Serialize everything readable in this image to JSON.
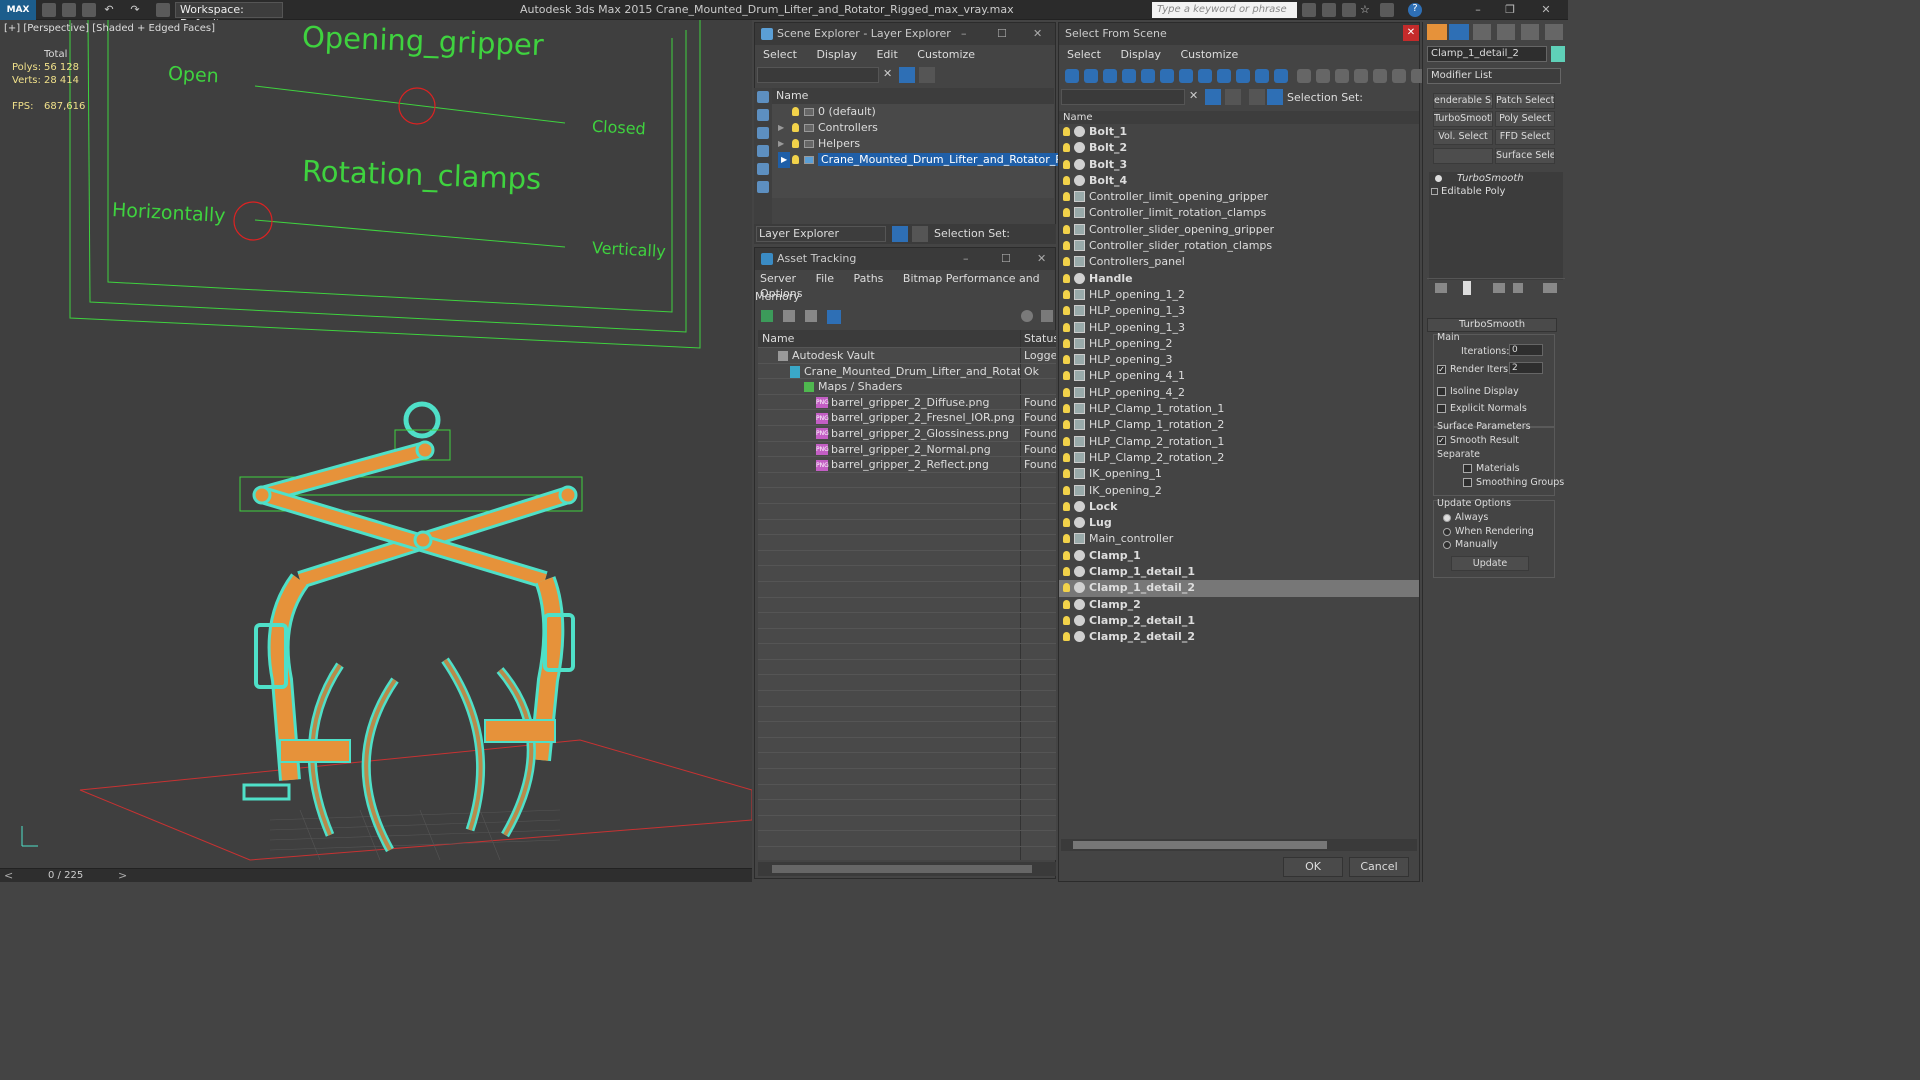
{
  "titlebar": {
    "logo": "MAX",
    "workspace": "Workspace: Default",
    "title": "Autodesk 3ds Max  2015    Crane_Mounted_Drum_Lifter_and_Rotator_Rigged_max_vray.max",
    "search_placeholder": "Type a keyword or phrase"
  },
  "viewport": {
    "label": "[+] [Perspective] [Shaded + Edged Faces]",
    "stats": {
      "header": "Total",
      "polys_label": "Polys:",
      "polys": "56 128",
      "verts_label": "Verts:",
      "verts": "28 414",
      "fps_label": "FPS:",
      "fps": "687,616"
    },
    "panel_text": {
      "opening_title": "Opening_gripper",
      "open": "Open",
      "closed": "Closed",
      "rotation_title": "Rotation_clamps",
      "horizontally": "Horizontally",
      "vertically": "Vertically"
    },
    "colors": {
      "wire": "#4fe0c8",
      "mesh": "#e6923a",
      "panel": "#3fd23f",
      "grid": "#c83232"
    }
  },
  "timeline": {
    "frame": "0 / 225"
  },
  "scene_explorer": {
    "title": "Scene Explorer - Layer Explorer",
    "menu": [
      "Select",
      "Display",
      "Edit",
      "Customize"
    ],
    "column": "Name",
    "layers": [
      "0 (default)",
      "Controllers",
      "Helpers",
      "Crane_Mounted_Drum_Lifter_and_Rotator_Rigged"
    ],
    "footer_dropdown": "Layer Explorer",
    "selection_set": "Selection Set:"
  },
  "asset_tracking": {
    "title": "Asset Tracking",
    "menu": [
      "Server",
      "File",
      "Paths",
      "Bitmap Performance and Memory",
      "Options"
    ],
    "columns": [
      "Name",
      "Status"
    ],
    "rows": [
      {
        "name": "Autodesk Vault",
        "status": "Logged"
      },
      {
        "name": "Crane_Mounted_Drum_Lifter_and_Rotator_Rigg...",
        "status": "Ok"
      },
      {
        "name": "Maps / Shaders",
        "status": ""
      },
      {
        "name": "barrel_gripper_2_Diffuse.png",
        "status": "Found"
      },
      {
        "name": "barrel_gripper_2_Fresnel_IOR.png",
        "status": "Found"
      },
      {
        "name": "barrel_gripper_2_Glossiness.png",
        "status": "Found"
      },
      {
        "name": "barrel_gripper_2_Normal.png",
        "status": "Found"
      },
      {
        "name": "barrel_gripper_2_Reflect.png",
        "status": "Found"
      }
    ],
    "png_label": "PNG"
  },
  "select_from_scene": {
    "title": "Select From Scene",
    "menu": [
      "Select",
      "Display",
      "Customize"
    ],
    "selection_set": "Selection Set:",
    "column": "Name",
    "objects": [
      "Bolt_1",
      "Bolt_2",
      "Bolt_3",
      "Bolt_4",
      "Controller_limit_opening_gripper",
      "Controller_limit_rotation_clamps",
      "Controller_slider_opening_gripper",
      "Controller_slider_rotation_clamps",
      "Controllers_panel",
      "Handle",
      "HLP_opening_1_2",
      "HLP_opening_1_3",
      "HLP_opening_1_3",
      "HLP_opening_2",
      "HLP_opening_3",
      "HLP_opening_4_1",
      "HLP_opening_4_2",
      "HLP_Clamp_1_rotation_1",
      "HLP_Clamp_1_rotation_2",
      "HLP_Clamp_2_rotation_1",
      "HLP_Clamp_2_rotation_2",
      "IK_opening_1",
      "IK_opening_2",
      "Lock",
      "Lug",
      "Main_controller",
      "Clamp_1",
      "Clamp_1_detail_1",
      "Clamp_1_detail_2",
      "Clamp_2",
      "Clamp_2_detail_1",
      "Clamp_2_detail_2"
    ],
    "ok": "OK",
    "cancel": "Cancel"
  },
  "command_panel": {
    "object_name": "Clamp_1_detail_2",
    "modifier_list": "Modifier List",
    "buttons": [
      "enderable Spli",
      "Patch Select",
      "TurboSmooth",
      "Poly Select",
      "Vol. Select",
      "FFD Select",
      "",
      "Surface Select"
    ],
    "stack": [
      "TurboSmooth",
      "Editable Poly"
    ],
    "rollout_title": "TurboSmooth",
    "main": "Main",
    "iterations_label": "Iterations:",
    "iterations": "0",
    "render_iters_label": "Render Iters:",
    "render_iters": "2",
    "isoline": "Isoline Display",
    "explicit_normals": "Explicit Normals",
    "surface_params": "Surface Parameters",
    "smooth_result": "Smooth Result",
    "separate": "Separate",
    "materials": "Materials",
    "smoothing_groups": "Smoothing Groups",
    "update_options": "Update Options",
    "always": "Always",
    "when_rendering": "When Rendering",
    "manually": "Manually",
    "update": "Update"
  }
}
